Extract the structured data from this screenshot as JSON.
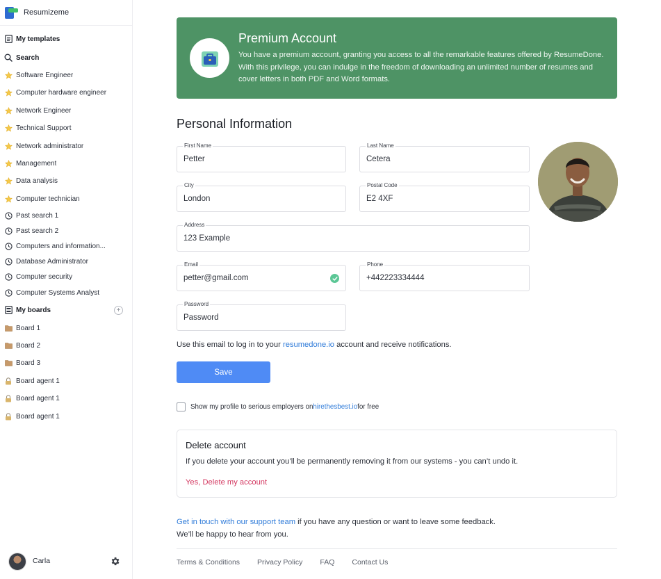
{
  "brand": {
    "name": "Resumizeme"
  },
  "sidebar": {
    "my_templates": "My templates",
    "search": "Search",
    "starred": [
      "Software Engineer",
      "Computer hardware engineer",
      "Network Engineer",
      "Technical Support",
      "Network administrator",
      "Management",
      "Data analysis",
      "Computer technician"
    ],
    "history": [
      "Past search 1",
      "Past search 2",
      "Computers and information...",
      "Database Administrator",
      "Computer security",
      "Computer Systems Analyst"
    ],
    "my_boards": "My boards",
    "boards": [
      "Board 1",
      "Board 2",
      "Board 3"
    ],
    "agents": [
      "Board agent 1",
      "Board agent 1",
      "Board agent 1"
    ],
    "add_icon": "plus-icon"
  },
  "user": {
    "name": "Carla",
    "settings_icon": "gear-icon"
  },
  "banner": {
    "title": "Premium Account",
    "description": "You have a premium account, granting you access to all the remarkable features offered by ResumeDone. With this privilege, you can indulge in the freedom of downloading an unlimited number of resumes and cover letters in both PDF and Word formats.",
    "icon": "briefcase-icon",
    "color": "#4e9365"
  },
  "personal": {
    "title": "Personal Information",
    "first_name": {
      "label": "First Name",
      "value": "Petter"
    },
    "last_name": {
      "label": "Last Name",
      "value": "Cetera"
    },
    "city": {
      "label": "City",
      "value": "London"
    },
    "postal_code": {
      "label": "Postal Code",
      "value": "E2 4XF"
    },
    "address": {
      "label": "Address",
      "value": "123 Example"
    },
    "email": {
      "label": "Email",
      "value": "petter@gmail.com"
    },
    "phone": {
      "label": "Phone",
      "value": "+442223334444"
    },
    "password": {
      "label": "Password",
      "placeholder": "Password"
    },
    "hint_before": "Use this email to log in to your ",
    "hint_link": "resumedone.io",
    "hint_after": " account and receive notifications.",
    "save_label": "Save"
  },
  "consent": {
    "before": "Show my profile to serious employers on ",
    "link": "hirethesbest.io",
    "after": " for free"
  },
  "delete": {
    "title": "Delete account",
    "description": "If you delete your account you’ll be permanently removing it from our systems - you can’t undo it.",
    "action": "Yes, Delete my account"
  },
  "support": {
    "link": "Get in touch with our support team",
    "line1_after": " if you have any question or want to leave some feedback.",
    "line2": "We’ll be happy to hear from you."
  },
  "footer": {
    "links": [
      "Terms & Conditions",
      "Privacy Policy",
      "FAQ",
      "Contact Us"
    ]
  },
  "colors": {
    "accent": "#4f8bf5",
    "link": "#2f7bd9",
    "danger": "#d3365f",
    "valid": "#5cc796"
  }
}
